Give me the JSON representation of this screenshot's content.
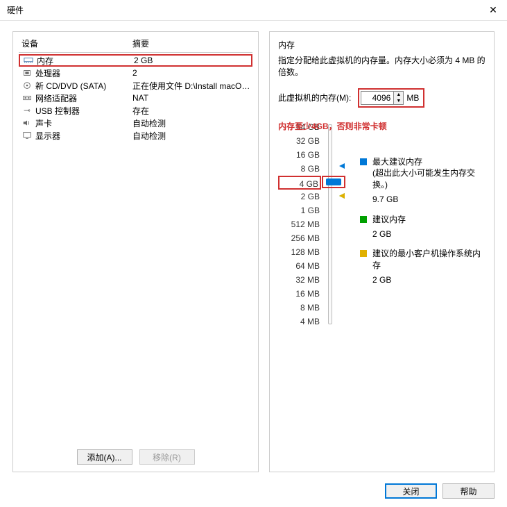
{
  "title": "硬件",
  "left": {
    "header_device": "设备",
    "header_summary": "摘要",
    "devices": [
      {
        "name": "内存",
        "summary": "2 GB"
      },
      {
        "name": "处理器",
        "summary": "2"
      },
      {
        "name": "新 CD/DVD (SATA)",
        "summary": "正在使用文件 D:\\Install macOS..."
      },
      {
        "name": "网络适配器",
        "summary": "NAT"
      },
      {
        "name": "USB 控制器",
        "summary": "存在"
      },
      {
        "name": "声卡",
        "summary": "自动检测"
      },
      {
        "name": "显示器",
        "summary": "自动检测"
      }
    ],
    "add_btn": "添加(A)...",
    "remove_btn": "移除(R)"
  },
  "right": {
    "section_title": "内存",
    "desc": "指定分配给此虚拟机的内存量。内存大小必须为 4 MB 的倍数。",
    "mem_label": "此虚拟机的内存(M):",
    "mem_value": "4096",
    "mem_unit": "MB",
    "annotation": "内存至少4GB，否则非常卡顿",
    "ticks": [
      "64 GB",
      "32 GB",
      "16 GB",
      "8 GB",
      "4 GB",
      "2 GB",
      "1 GB",
      "512 MB",
      "256 MB",
      "128 MB",
      "64 MB",
      "32 MB",
      "16 MB",
      "8 MB",
      "4 MB"
    ],
    "legend": {
      "max": {
        "label": "最大建议内存",
        "note": "(超出此大小可能发生内存交换。)",
        "value": "9.7 GB"
      },
      "rec": {
        "label": "建议内存",
        "value": "2 GB"
      },
      "min": {
        "label": "建议的最小客户机操作系统内存",
        "value": "2 GB"
      }
    }
  },
  "footer": {
    "close": "关闭",
    "help": "帮助"
  }
}
